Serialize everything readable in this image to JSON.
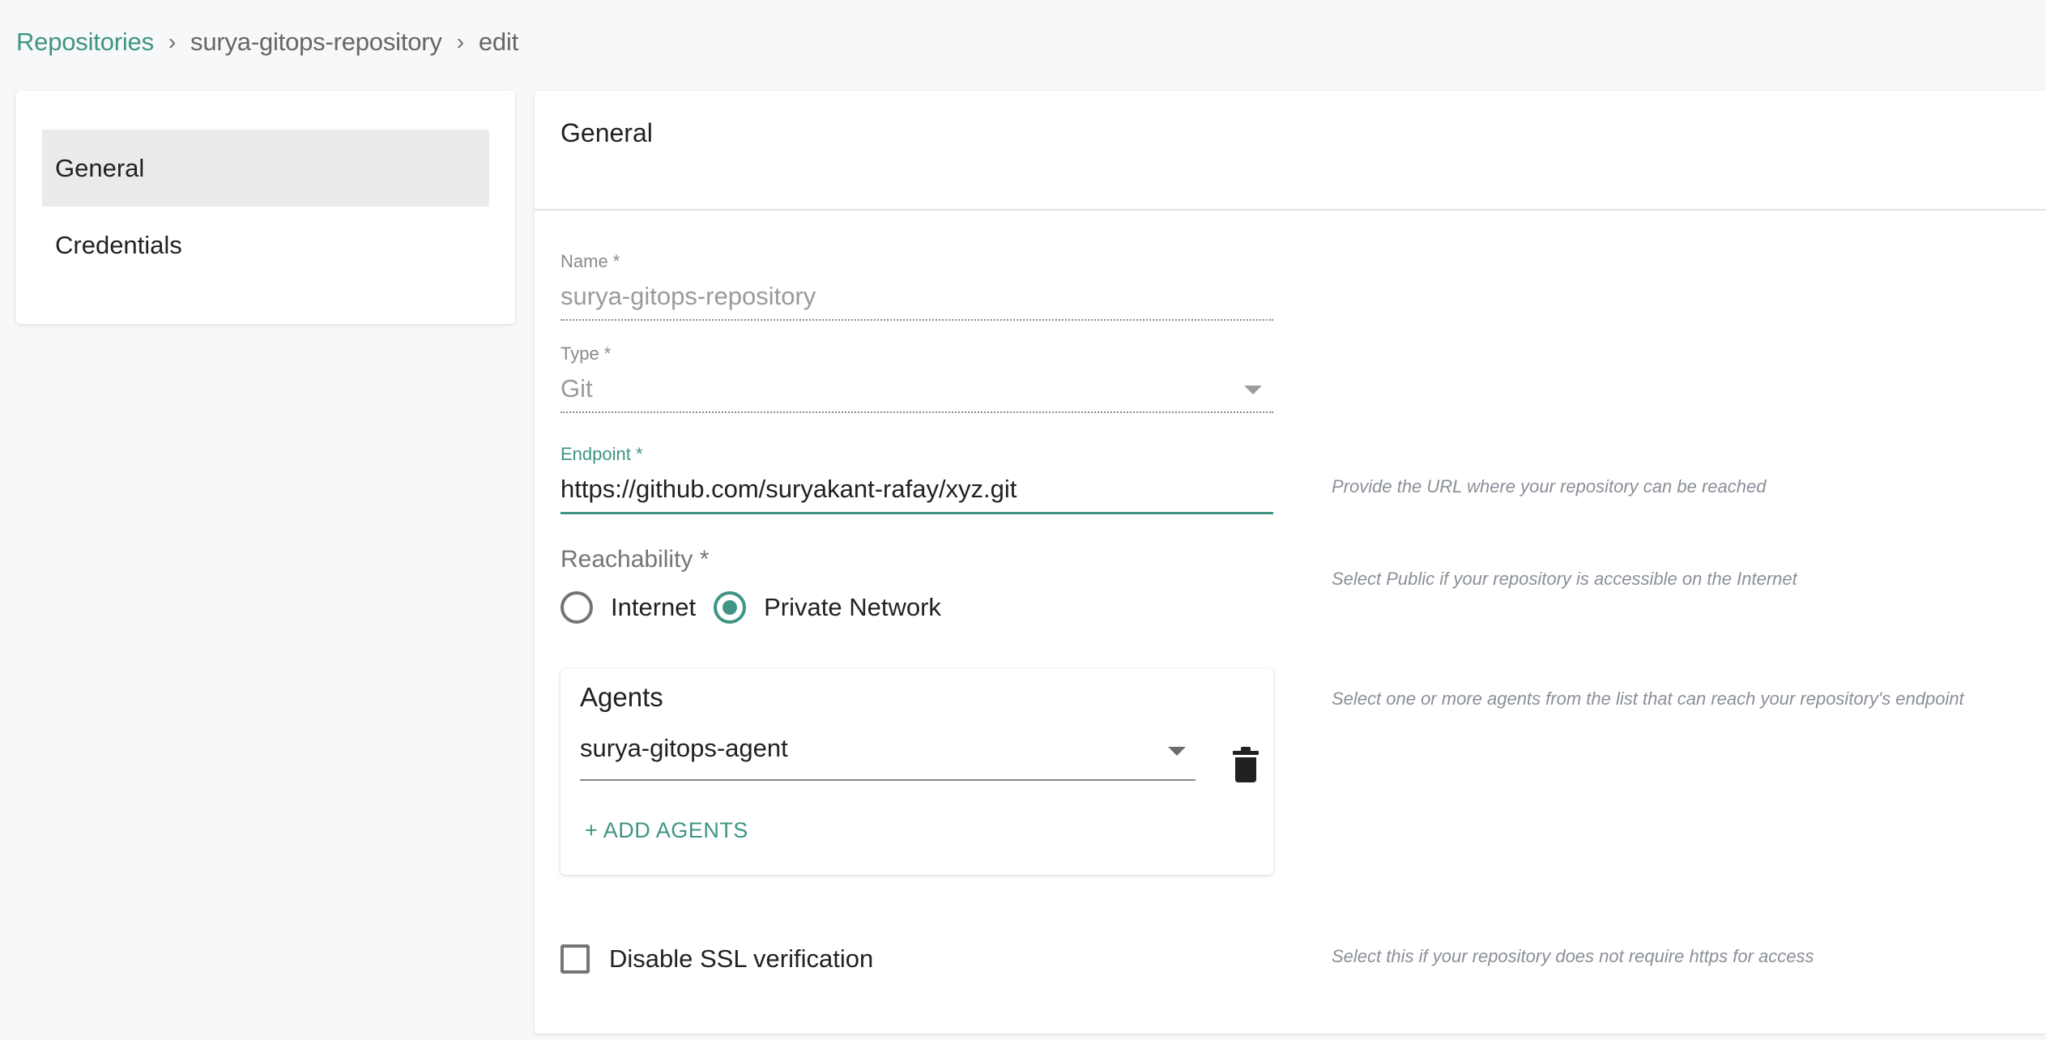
{
  "breadcrumb": {
    "items": [
      {
        "label": "Repositories",
        "link": true
      },
      {
        "label": "surya-gitops-repository",
        "link": false
      },
      {
        "label": "edit",
        "link": false
      }
    ],
    "separator": "›"
  },
  "sidebar": {
    "items": [
      {
        "label": "General",
        "active": true
      },
      {
        "label": "Credentials",
        "active": false
      }
    ]
  },
  "main": {
    "title": "General",
    "fields": {
      "name": {
        "label": "Name *",
        "value": "surya-gitops-repository",
        "disabled": true
      },
      "type": {
        "label": "Type *",
        "value": "Git",
        "disabled": true
      },
      "endpoint": {
        "label": "Endpoint *",
        "value": "https://github.com/suryakant-rafay/xyz.git",
        "focused": true
      }
    },
    "reachability": {
      "label": "Reachability *",
      "options": [
        {
          "label": "Internet",
          "checked": false
        },
        {
          "label": "Private Network",
          "checked": true
        }
      ]
    },
    "agents": {
      "title": "Agents",
      "selected": "surya-gitops-agent",
      "add_label": "+ ADD  AGENTS",
      "delete_icon": "trash-icon"
    },
    "ssl": {
      "label": "Disable SSL verification",
      "checked": false
    },
    "hints": {
      "endpoint": "Provide the URL where your repository can be reached",
      "reachability": "Select Public if your repository is accessible on the Internet",
      "agents": "Select one or more agents from the list that can reach your repository's endpoint",
      "ssl": "Select this if your repository does not require https for access"
    }
  },
  "colors": {
    "accent": "#3f9484",
    "background": "#f7f8fa",
    "active_item": "#ebebeb"
  }
}
